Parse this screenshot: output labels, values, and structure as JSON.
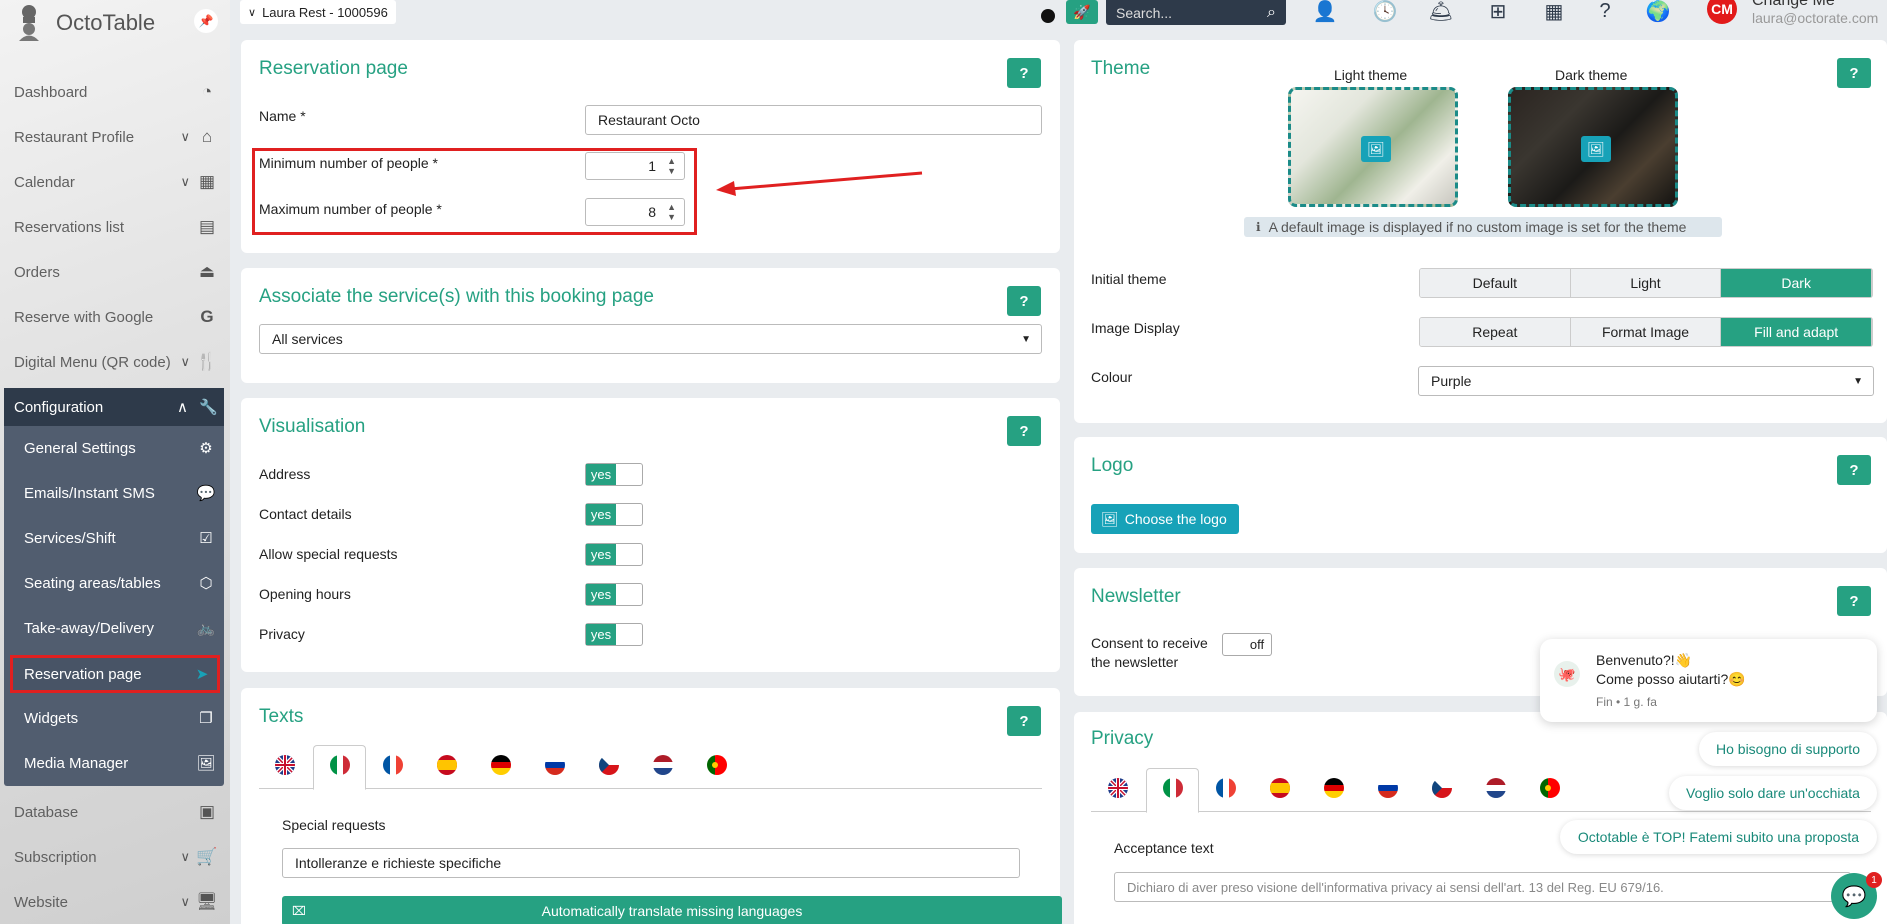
{
  "app": {
    "name": "OctoTable"
  },
  "topbar": {
    "restaurant": "Laura Rest - 1000596",
    "search_placeholder": "Search...",
    "user_initials": "CM",
    "user_name": "Change Me",
    "user_email": "laura@octorate.com"
  },
  "sidebar": {
    "items": [
      {
        "label": "Dashboard"
      },
      {
        "label": "Restaurant Profile"
      },
      {
        "label": "Calendar"
      },
      {
        "label": "Reservations list"
      },
      {
        "label": "Orders"
      },
      {
        "label": "Reserve with Google"
      },
      {
        "label": "Digital Menu (QR code)"
      }
    ],
    "config_label": "Configuration",
    "config_items": [
      {
        "label": "General Settings"
      },
      {
        "label": "Emails/Instant SMS"
      },
      {
        "label": "Services/Shift"
      },
      {
        "label": "Seating areas/tables"
      },
      {
        "label": "Take-away/Delivery"
      },
      {
        "label": "Reservation page"
      },
      {
        "label": "Widgets"
      },
      {
        "label": "Media Manager"
      }
    ],
    "bottom_items": [
      {
        "label": "Database"
      },
      {
        "label": "Subscription"
      },
      {
        "label": "Website"
      }
    ]
  },
  "reservation_page": {
    "title": "Reservation page",
    "help": "?",
    "name_label": "Name  *",
    "name_value": "Restaurant Octo",
    "min_label": "Minimum number of people  *",
    "min_value": "1",
    "max_label": "Maximum number of people  *",
    "max_value": "8"
  },
  "services": {
    "title": "Associate the service(s) with this booking page",
    "help": "?",
    "value": "All services"
  },
  "visualisation": {
    "title": "Visualisation",
    "help": "?",
    "rows": [
      {
        "label": "Address",
        "state": "yes"
      },
      {
        "label": "Contact details",
        "state": "yes"
      },
      {
        "label": "Allow special requests",
        "state": "yes"
      },
      {
        "label": "Opening hours",
        "state": "yes"
      },
      {
        "label": "Privacy",
        "state": "yes"
      }
    ]
  },
  "texts": {
    "title": "Texts",
    "help": "?",
    "special_label": "Special requests",
    "special_value": "Intolleranze e richieste specifiche",
    "translate_button": "Automatically translate missing languages"
  },
  "theme": {
    "title": "Theme",
    "help": "?",
    "light_label": "Light theme",
    "dark_label": "Dark theme",
    "info": "A default image is displayed if no custom image is set for the theme",
    "initial_label": "Initial theme",
    "initial_options": [
      "Default",
      "Light",
      "Dark"
    ],
    "initial_selected": "Dark",
    "display_label": "Image Display",
    "display_options": [
      "Repeat",
      "Format Image",
      "Fill and adapt"
    ],
    "display_selected": "Fill and adapt",
    "colour_label": "Colour",
    "colour_value": "Purple"
  },
  "logo": {
    "title": "Logo",
    "help": "?",
    "button": "Choose the logo"
  },
  "newsletter": {
    "title": "Newsletter",
    "help": "?",
    "consent_line1": "Consent to receive",
    "consent_line2": "the newsletter",
    "state": "off"
  },
  "privacy": {
    "title": "Privacy",
    "acceptance_label": "Acceptance text",
    "acceptance_placeholder": "Dichiaro di aver preso visione dell'informativa privacy ai sensi dell'art. 13 del Reg. EU 679/16."
  },
  "chat": {
    "greeting1": "Benvenuto?!👋",
    "greeting2": "Come posso aiutarti?😊",
    "meta": "Fin • 1 g. fa",
    "options": [
      "Ho bisogno di supporto",
      "Voglio solo dare un'occhiata",
      "Octotable è TOP! Fatemi subito una proposta"
    ],
    "badge": "1"
  },
  "colors": {
    "accent": "#26a182",
    "sidebar_dark": "#2e3a4a",
    "highlight": "#e02020"
  }
}
